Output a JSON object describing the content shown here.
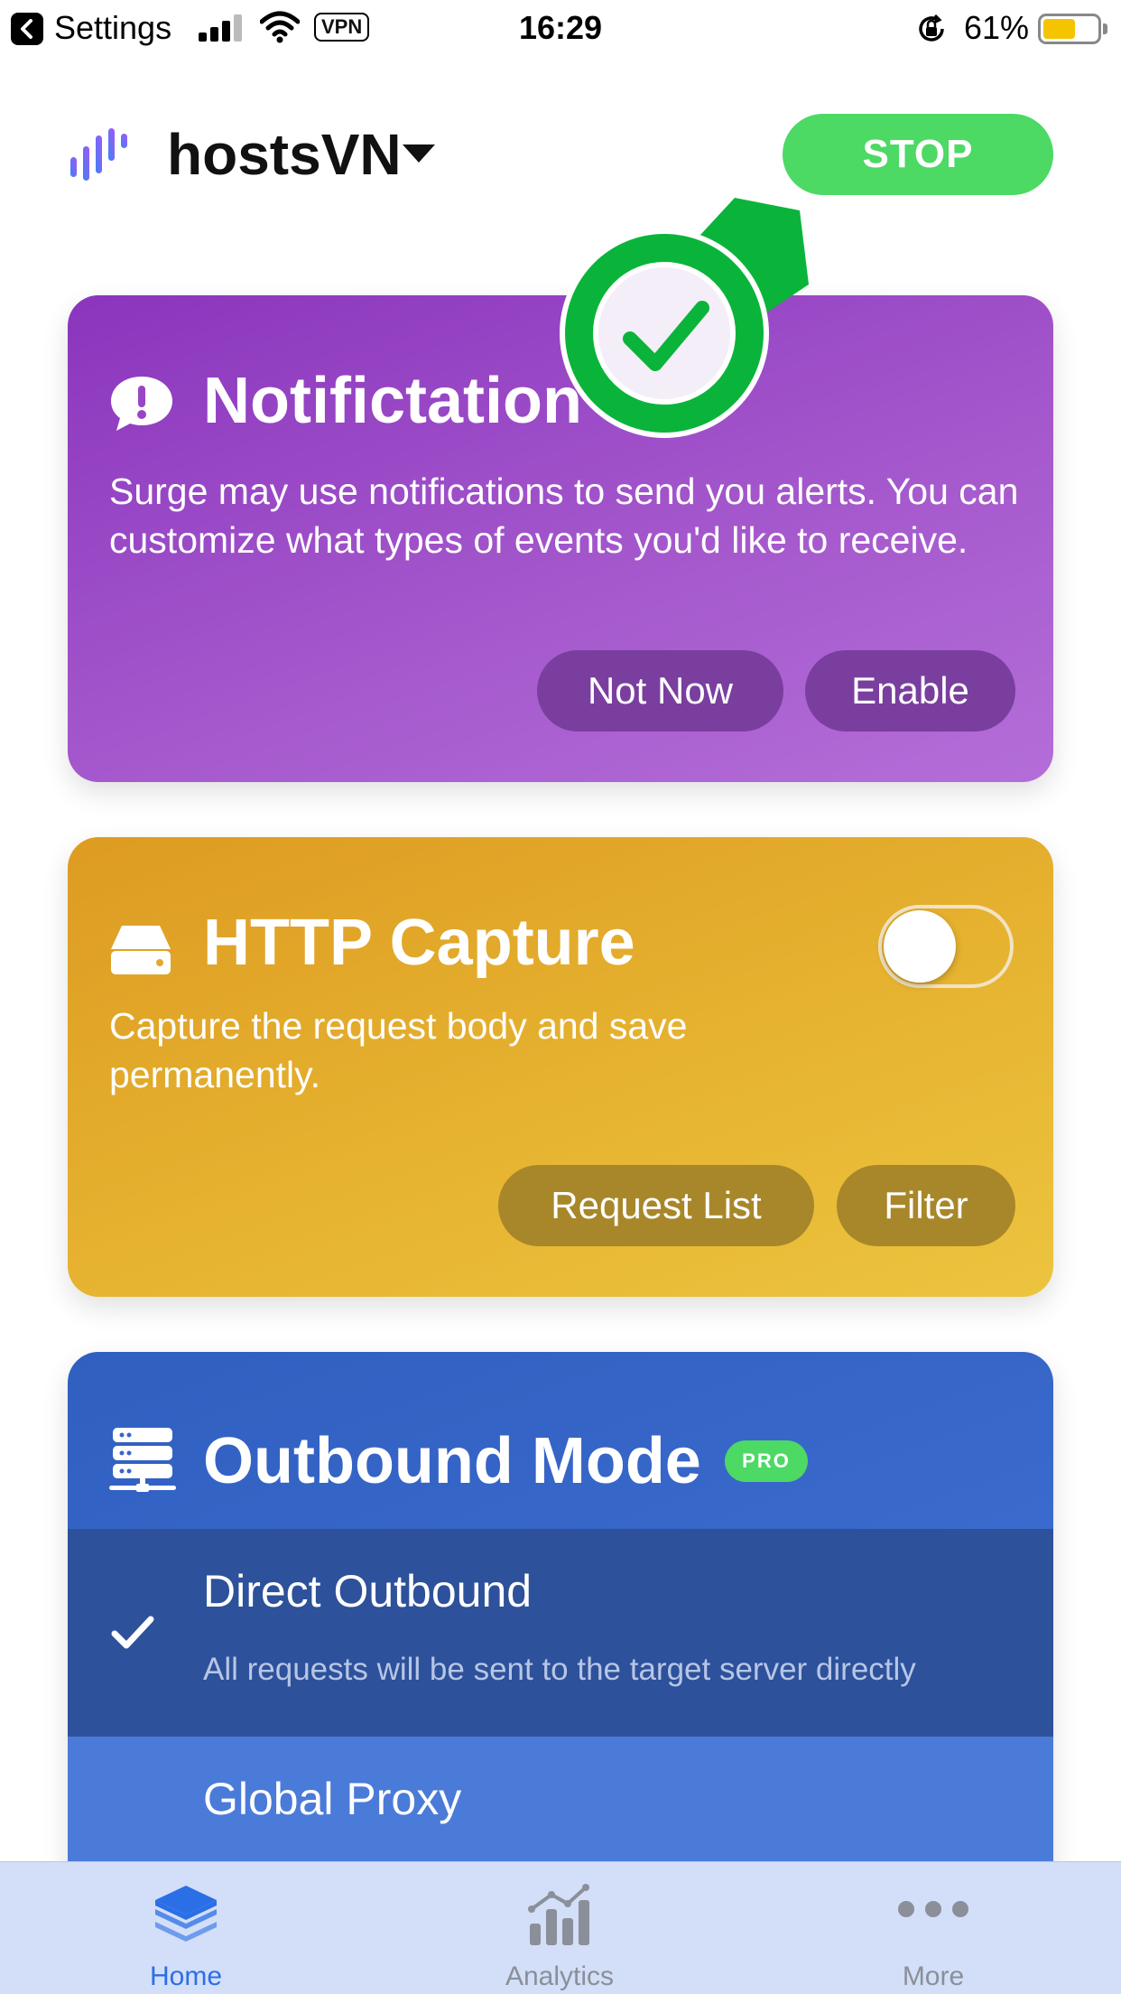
{
  "status_bar": {
    "back_app": "Settings",
    "vpn": "VPN",
    "time": "16:29",
    "battery_percent": "61%",
    "battery_level": 0.61,
    "battery_color": "#f5c400"
  },
  "header": {
    "profile_name": "hostsVN",
    "stop_label": "STOP",
    "stop_color": "#4cd964"
  },
  "notifications_card": {
    "icon": "notification-bubble-icon",
    "title": "Notifictation",
    "description": "Surge may use notifications to send you alerts. You can customize what types of events you'd like to receive.",
    "not_now_label": "Not Now",
    "enable_label": "Enable"
  },
  "http_capture_card": {
    "icon": "drive-icon",
    "title": "HTTP Capture",
    "description": "Capture the request body and save permanently.",
    "toggle_on": false,
    "request_list_label": "Request List",
    "filter_label": "Filter"
  },
  "outbound_card": {
    "icon": "server-icon",
    "title": "Outbound Mode",
    "badge": "PRO",
    "options": [
      {
        "name": "Direct Outbound",
        "subtitle": "All requests will be sent to the target server directly",
        "selected": true
      },
      {
        "name": "Global Proxy",
        "selected": false
      }
    ]
  },
  "tabbar": {
    "tabs": [
      {
        "label": "Home",
        "icon": "layers-icon",
        "active": true
      },
      {
        "label": "Analytics",
        "icon": "analytics-icon",
        "active": false
      },
      {
        "label": "More",
        "icon": "more-dots-icon",
        "active": false
      }
    ],
    "active_color": "#2b6fe6",
    "inactive_color": "#8a8f99"
  }
}
